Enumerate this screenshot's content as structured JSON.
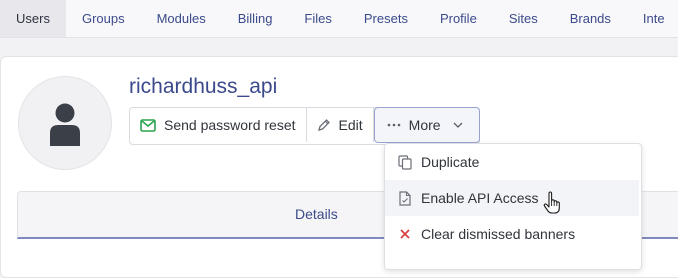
{
  "tabs": [
    {
      "label": "Users",
      "active": true
    },
    {
      "label": "Groups"
    },
    {
      "label": "Modules"
    },
    {
      "label": "Billing"
    },
    {
      "label": "Files"
    },
    {
      "label": "Presets"
    },
    {
      "label": "Profile"
    },
    {
      "label": "Sites"
    },
    {
      "label": "Brands"
    },
    {
      "label": "Inte"
    }
  ],
  "user": {
    "username": "richardhuss_api",
    "avatar_icon": "user-icon"
  },
  "actions": {
    "send_password_reset": "Send password reset",
    "edit": "Edit",
    "more": "More"
  },
  "menu": {
    "items": [
      {
        "label": "Duplicate",
        "icon": "duplicate-icon"
      },
      {
        "label": "Enable API Access",
        "icon": "document-icon"
      },
      {
        "label": "Clear dismissed banners",
        "icon": "x-icon"
      }
    ]
  },
  "subtabs": {
    "details": "Details"
  },
  "colors": {
    "accent": "#3c4a8c",
    "success": "#2aa44f",
    "danger": "#d93a3a"
  }
}
